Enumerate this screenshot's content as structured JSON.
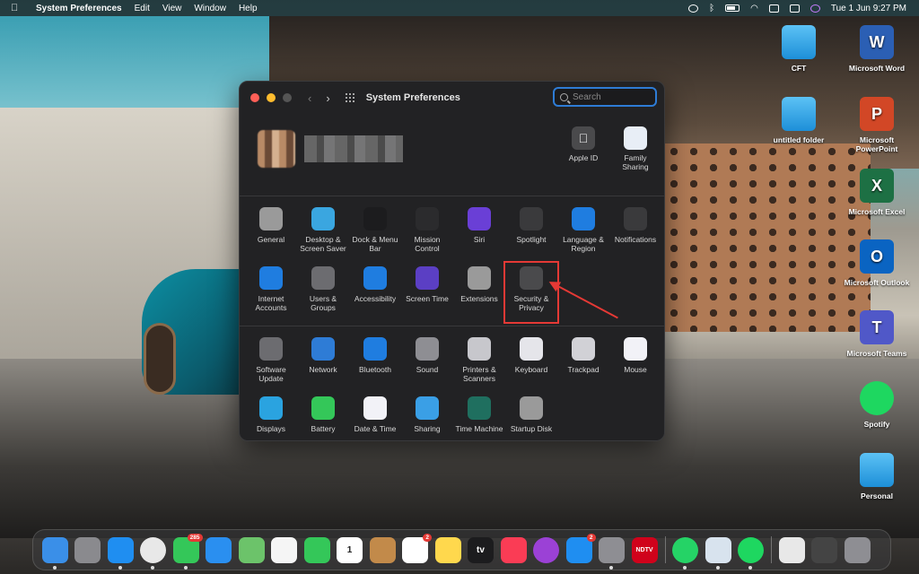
{
  "menubar": {
    "app_name": "System Preferences",
    "menus": [
      "Edit",
      "View",
      "Window",
      "Help"
    ],
    "datetime": "Tue 1 Jun  9:27 PM"
  },
  "window": {
    "title": "System Preferences",
    "search_placeholder": "Search",
    "top_panes": [
      {
        "label": "Apple ID",
        "icon": "apple-icon",
        "color": "#4a4a4c"
      },
      {
        "label": "Family Sharing",
        "icon": "family-icon",
        "color": "#e8eef6"
      }
    ],
    "section1": [
      [
        {
          "label": "General",
          "icon": "general-icon",
          "color": "#9a9a9a"
        },
        {
          "label": "Desktop & Screen Saver",
          "icon": "desktop-icon",
          "color": "#3aa6e0"
        },
        {
          "label": "Dock & Menu Bar",
          "icon": "dock-icon",
          "color": "#1c1c1e"
        },
        {
          "label": "Mission Control",
          "icon": "mission-control-icon",
          "color": "#2b2b2d"
        },
        {
          "label": "Siri",
          "icon": "siri-icon",
          "color": "#6a3fd6"
        },
        {
          "label": "Spotlight",
          "icon": "spotlight-icon",
          "color": "#3a3a3c"
        },
        {
          "label": "Language & Region",
          "icon": "flag-icon",
          "color": "#1f7de0"
        },
        {
          "label": "Notifications",
          "icon": "bell-icon",
          "color": "#3a3a3c"
        }
      ],
      [
        {
          "label": "Internet Accounts",
          "icon": "at-icon",
          "color": "#1f7de0"
        },
        {
          "label": "Users & Groups",
          "icon": "users-icon",
          "color": "#6c6c70"
        },
        {
          "label": "Accessibility",
          "icon": "accessibility-icon",
          "color": "#1f7de0"
        },
        {
          "label": "Screen Time",
          "icon": "hourglass-icon",
          "color": "#5b3fc4"
        },
        {
          "label": "Extensions",
          "icon": "puzzle-icon",
          "color": "#9a9a9a"
        },
        {
          "label": "Security & Privacy",
          "icon": "security-house-icon",
          "color": "#4a4a4c"
        }
      ]
    ],
    "section2": [
      [
        {
          "label": "Software Update",
          "icon": "gear-icon",
          "color": "#6c6c70"
        },
        {
          "label": "Network",
          "icon": "globe-icon",
          "color": "#2e7cd6"
        },
        {
          "label": "Bluetooth",
          "icon": "bluetooth-icon",
          "color": "#1f7de0"
        },
        {
          "label": "Sound",
          "icon": "speaker-icon",
          "color": "#8e8e93"
        },
        {
          "label": "Printers & Scanners",
          "icon": "printer-icon",
          "color": "#c7c7cc"
        },
        {
          "label": "Keyboard",
          "icon": "keyboard-icon",
          "color": "#e5e5ea"
        },
        {
          "label": "Trackpad",
          "icon": "trackpad-icon",
          "color": "#d1d1d6"
        },
        {
          "label": "Mouse",
          "icon": "mouse-icon",
          "color": "#f2f2f7"
        }
      ],
      [
        {
          "label": "Displays",
          "icon": "display-icon",
          "color": "#2aa3e0"
        },
        {
          "label": "Battery",
          "icon": "battery-icon",
          "color": "#34c759"
        },
        {
          "label": "Date & Time",
          "icon": "clock-icon",
          "color": "#f2f2f7"
        },
        {
          "label": "Sharing",
          "icon": "folder-share-icon",
          "color": "#3a9fe6"
        },
        {
          "label": "Time Machine",
          "icon": "time-machine-icon",
          "color": "#1f6f5f"
        },
        {
          "label": "Startup Disk",
          "icon": "disk-icon",
          "color": "#9a9a9a"
        }
      ]
    ]
  },
  "desktop": [
    {
      "label": "CFT",
      "icon": "folder-icon"
    },
    {
      "label": "Microsoft Word",
      "icon": "word-icon",
      "glyph": "W",
      "color": "#2b5fb4"
    },
    {
      "label": "untitled folder",
      "icon": "folder-icon"
    },
    {
      "label": "Microsoft PowerPoint",
      "icon": "powerpoint-icon",
      "glyph": "P",
      "color": "#d24726"
    },
    {
      "label": "Microsoft Excel",
      "icon": "excel-icon",
      "glyph": "X",
      "color": "#1d7044"
    },
    {
      "label": "Microsoft Outlook",
      "icon": "outlook-icon",
      "glyph": "O",
      "color": "#0a64c2"
    },
    {
      "label": "Microsoft Teams",
      "icon": "teams-icon",
      "glyph": "T",
      "color": "#5058c8"
    },
    {
      "label": "Spotify",
      "icon": "spotify-icon",
      "glyph": "",
      "color": "#1ed760"
    },
    {
      "label": "Personal",
      "icon": "folder-icon"
    }
  ],
  "dock": {
    "apps": [
      {
        "name": "finder",
        "color": "#3a8fe8",
        "dot": true
      },
      {
        "name": "launchpad",
        "color": "#8a8a8e",
        "dot": false
      },
      {
        "name": "safari",
        "color": "#1f8ef1",
        "dot": true
      },
      {
        "name": "chrome",
        "color": "#e8e8e8",
        "dot": true
      },
      {
        "name": "messages",
        "color": "#34c759",
        "dot": true,
        "badge": "285"
      },
      {
        "name": "mail",
        "color": "#2a8ff0",
        "dot": false
      },
      {
        "name": "maps",
        "color": "#6cc36a",
        "dot": false
      },
      {
        "name": "photos",
        "color": "#f5f5f5",
        "dot": false
      },
      {
        "name": "facetime",
        "color": "#34c759",
        "dot": false
      },
      {
        "name": "calendar",
        "color": "#ffffff",
        "dot": false,
        "glyph": "1"
      },
      {
        "name": "contacts",
        "color": "#c28a4a",
        "dot": false
      },
      {
        "name": "reminders",
        "color": "#ffffff",
        "dot": false,
        "badge": "2"
      },
      {
        "name": "notes",
        "color": "#ffd84d",
        "dot": false
      },
      {
        "name": "appletv",
        "color": "#1c1c1e",
        "dot": false,
        "glyph": "tv"
      },
      {
        "name": "music",
        "color": "#fa3c55",
        "dot": false
      },
      {
        "name": "podcasts",
        "color": "#9b41d6",
        "dot": false
      },
      {
        "name": "appstore",
        "color": "#1f8ef1",
        "dot": false,
        "badge": "2"
      },
      {
        "name": "system-preferences",
        "color": "#8e8e93",
        "dot": true
      },
      {
        "name": "ndtv",
        "color": "#d0021b",
        "dot": false,
        "glyph": "NDTV"
      },
      {
        "name": "whatsapp",
        "color": "#25d366",
        "dot": true
      },
      {
        "name": "preview",
        "color": "#d8e3ee",
        "dot": true
      },
      {
        "name": "spotify",
        "color": "#1ed760",
        "dot": true
      },
      {
        "name": "document-1",
        "color": "#e8e8e8",
        "dot": false
      },
      {
        "name": "document-2",
        "color": "#444",
        "dot": false
      },
      {
        "name": "trash",
        "color": "#8e8e93",
        "dot": false
      }
    ]
  }
}
